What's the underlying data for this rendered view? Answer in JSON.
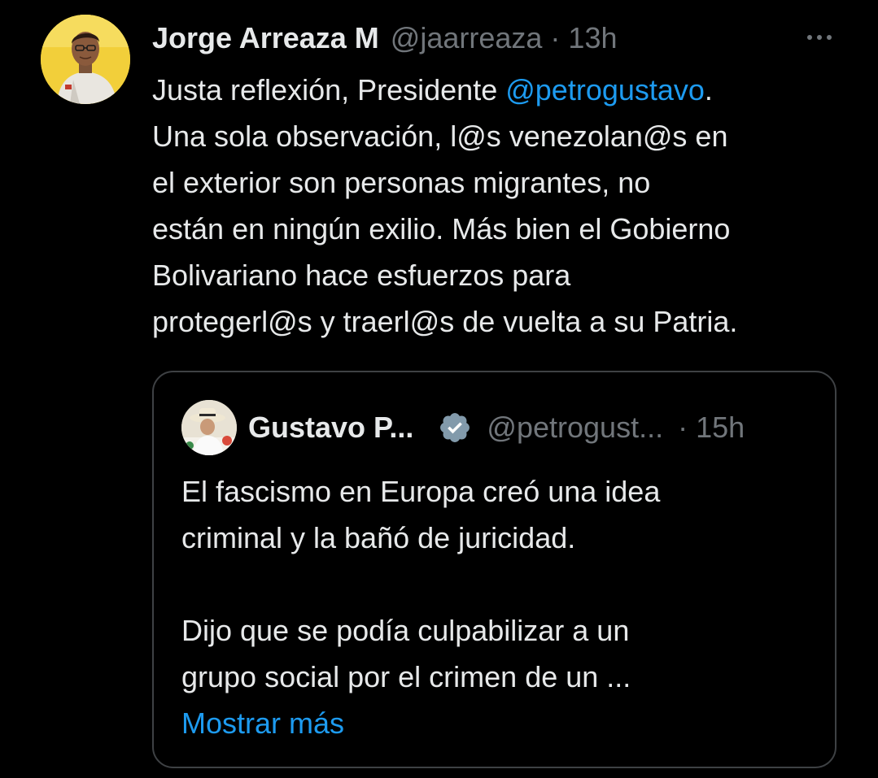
{
  "tweet": {
    "author": {
      "display_name": "Jorge Arreaza M",
      "handle": "@jaarreaza",
      "separator": "·",
      "time": "13h",
      "avatar_icon": "profile-photo"
    },
    "more_icon": "more-options-icon",
    "text": {
      "line1_before": "Justa reflexión, Presidente ",
      "line1_mention": "@petrogustavo",
      "line1_after": ".",
      "line2": "Una sola observación, l@s venezolan@s en",
      "line3": "el exterior son personas migrantes, no",
      "line4": "están en ningún exilio. Más bien el Gobierno",
      "line5": "Bolivariano hace esfuerzos para",
      "line6": "protegerl@s y traerl@s de vuelta a su Patria."
    }
  },
  "quoted_tweet": {
    "author": {
      "display_name": "Gustavo P...",
      "verified_icon": "verified-badge-icon",
      "handle": "@petrogust...",
      "separator": "·",
      "time": "15h"
    },
    "text": {
      "line1": "El fascismo en Europa creó una idea",
      "line2": "criminal y la bañó de juricidad.",
      "line3": "",
      "line4": "Dijo que se podía culpabilizar a un",
      "line5": "grupo social por el crimen de un ..."
    },
    "show_more_label": "Mostrar más"
  },
  "colors": {
    "background": "#000000",
    "primary_text": "#e7e9ea",
    "secondary_text": "#71767b",
    "link": "#1d9bf0",
    "border": "#3e4144"
  }
}
